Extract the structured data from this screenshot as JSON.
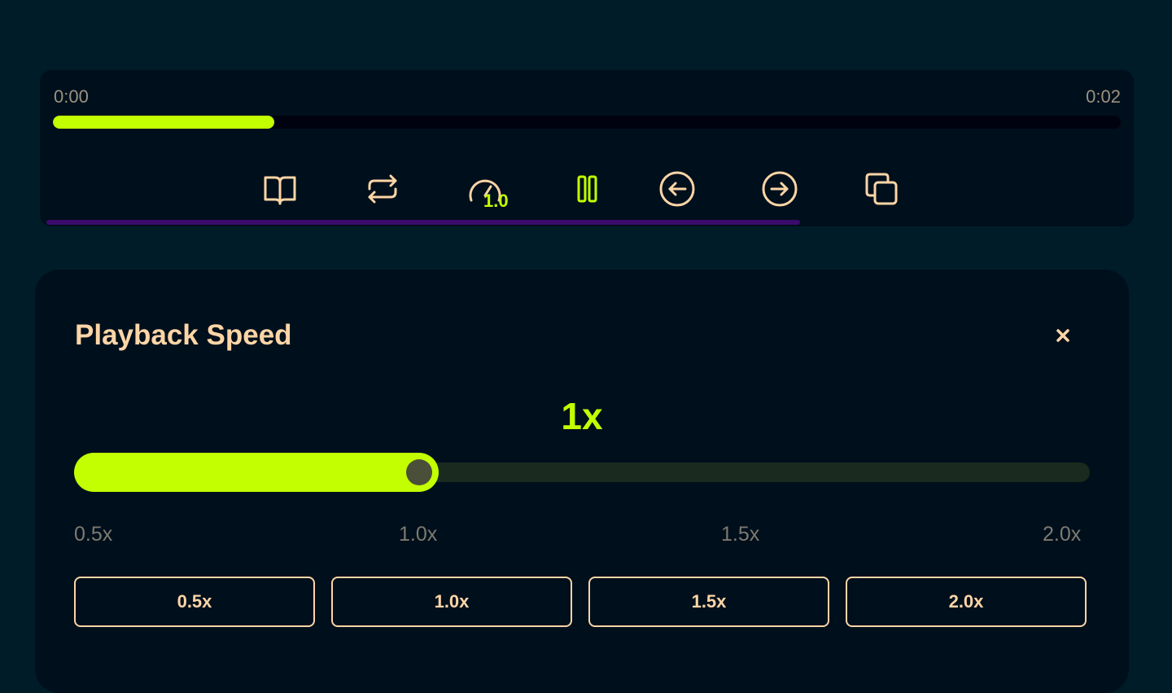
{
  "player": {
    "current_time": "0:00",
    "duration": "0:02",
    "progress": 0.207,
    "speed_badge": "1.0",
    "colors": {
      "accent": "#c3ff00",
      "icon": "#fdd5a6",
      "underline": "#3b0a6b"
    },
    "controls": [
      {
        "icon": "book-open-icon"
      },
      {
        "icon": "repeat-icon"
      },
      {
        "icon": "speedometer-icon"
      },
      {
        "icon": "pause-icon"
      },
      {
        "icon": "arrow-left-circle-icon"
      },
      {
        "icon": "arrow-right-circle-icon"
      },
      {
        "icon": "copy-icon"
      }
    ]
  },
  "speed_panel": {
    "title": "Playback Speed",
    "close_icon": "close-icon",
    "current_value": "1x",
    "slider_level": 0.333,
    "ticks": [
      "0.5x",
      "1.0x",
      "1.5x",
      "2.0x"
    ],
    "presets": [
      "0.5x",
      "1.0x",
      "1.5x",
      "2.0x"
    ]
  }
}
